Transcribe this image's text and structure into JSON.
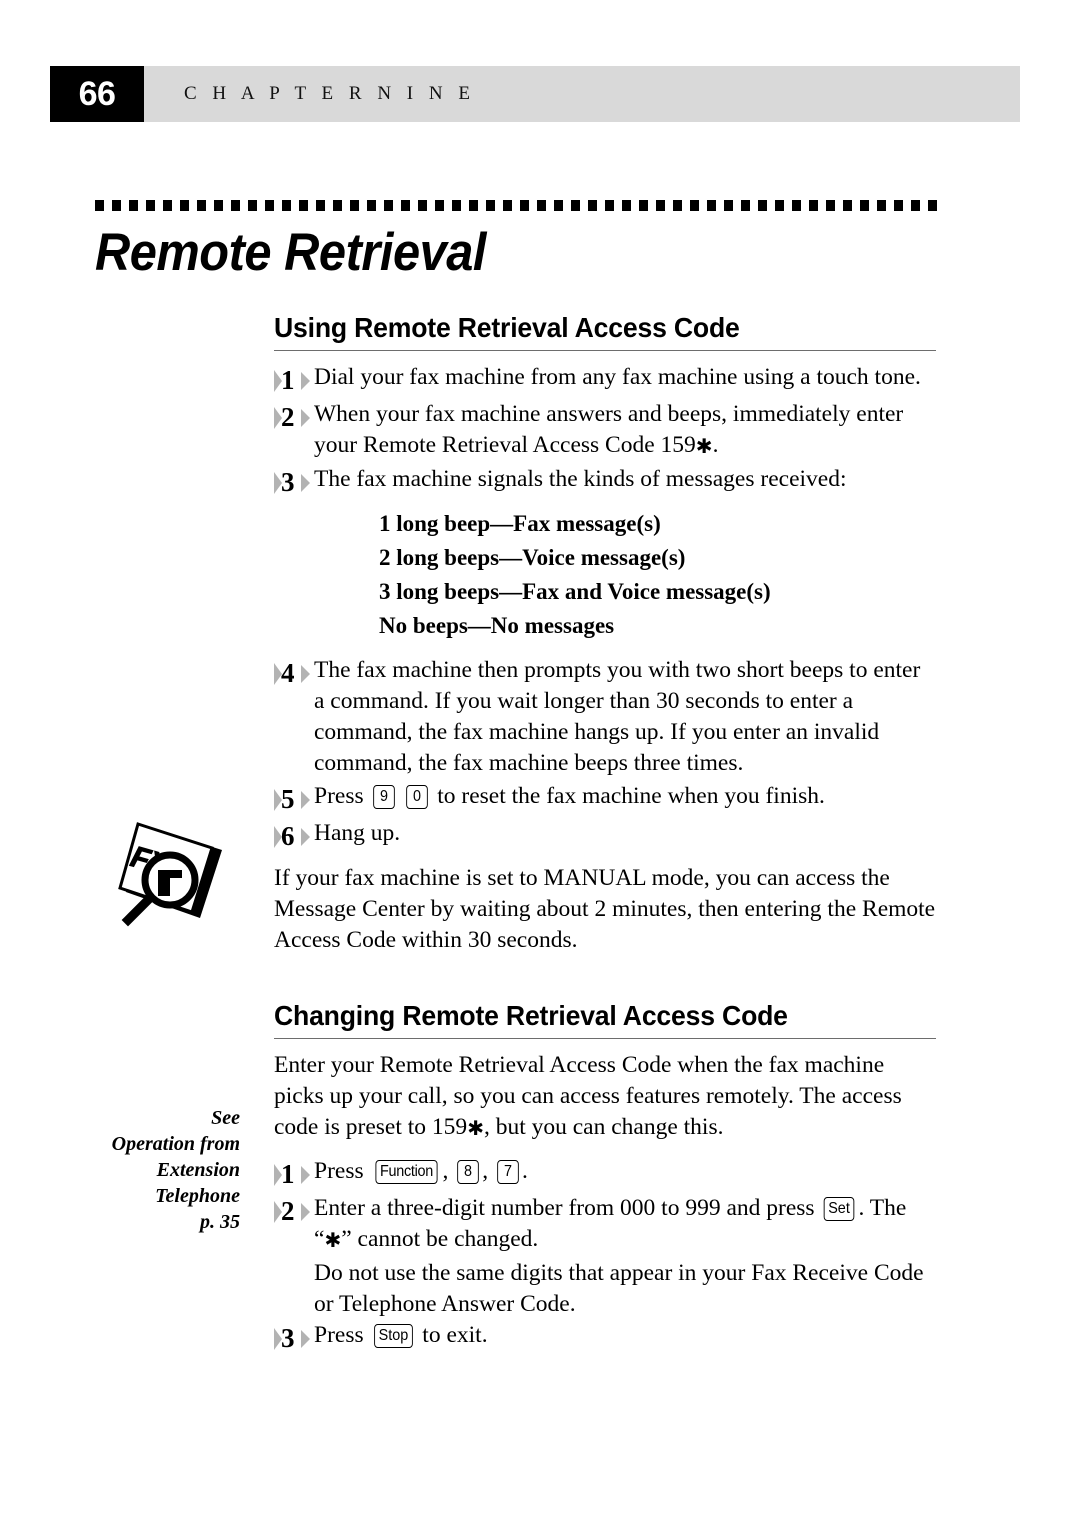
{
  "header": {
    "page_number": "66",
    "chapter_label": "C H A P T E R   N I N E"
  },
  "chapter_title": "Remote Retrieval",
  "sections": [
    {
      "heading": "Using Remote Retrieval Access Code",
      "steps": [
        {
          "number": "1",
          "text": "Dial your fax machine from any fax machine using a touch tone."
        },
        {
          "number": "2",
          "text_a": "When your fax machine answers and beeps, immediately enter your Remote Retrieval Access Code 159",
          "text_b": "."
        },
        {
          "number": "3",
          "text": "The fax machine signals the kinds of messages received:"
        },
        {
          "number": "4",
          "text": "The fax machine then prompts you with two short beeps to enter a command. If you wait longer than 30 seconds to enter a command, the fax machine hangs up. If you enter an invalid command, the fax machine beeps three times."
        },
        {
          "number": "5",
          "text_a": "Press",
          "key_1": "9",
          "key_2": "0",
          "text_b": "to reset the fax machine when you finish."
        },
        {
          "number": "6",
          "text": "Hang up."
        }
      ],
      "beep_list": [
        "1 long beep—Fax message(s)",
        "2 long beeps—Voice message(s)",
        "3 long beeps—Fax and Voice message(s)",
        "No beeps—No messages"
      ],
      "note": "If your fax machine is set to MANUAL mode, you can access the Message Center by waiting about 2 minutes, then entering the Remote Access Code within 30 seconds."
    },
    {
      "heading": "Changing Remote Retrieval Access Code",
      "intro_a": "Enter your Remote Retrieval Access Code when the fax machine picks up your call, so you can access features remotely. The access code is preset to 159",
      "intro_b": ", but you can change this.",
      "steps": [
        {
          "number": "1",
          "text_a": "Press",
          "key_1": "Function",
          "sep_1": ",",
          "key_2": "8",
          "sep_2": ",",
          "key_3": "7",
          "text_b": "."
        },
        {
          "number": "2",
          "text_a": "Enter a three-digit number from 000 to 999 and press",
          "key_1": "Set",
          "text_b": ". The “",
          "text_c": "” cannot be changed."
        },
        {
          "number": "3",
          "text_a": "Press",
          "key_1": "Stop",
          "text_b": "to exit."
        }
      ],
      "extra_text": "Do not use the same digits that appear in your Fax Receive Code or Telephone Answer Code."
    }
  ],
  "margin_note": {
    "line_1": "See",
    "line_2": "Operation from",
    "line_3": "Extension",
    "line_4": "Telephone",
    "line_5": "p. 35"
  },
  "icons": {
    "fyi_label": "FYI"
  },
  "symbols": {
    "star": "✱"
  },
  "colors": {
    "header_bar": "#d9d9d9",
    "page_box": "#000000",
    "marker_gray": "#b3b3b3",
    "rule_gray": "#6d6d6d"
  }
}
